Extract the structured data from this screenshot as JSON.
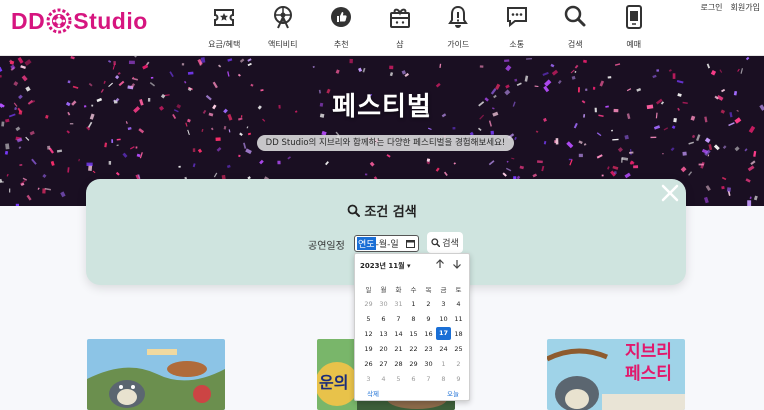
{
  "header": {
    "logo_text_left": "DD",
    "logo_text_right": "Studio",
    "nav": [
      {
        "label": "요금/혜택",
        "icon": "ticket-icon"
      },
      {
        "label": "액티비티",
        "icon": "ferris-wheel-icon"
      },
      {
        "label": "추천",
        "icon": "thumbs-up-icon"
      },
      {
        "label": "샵",
        "icon": "gift-box-icon"
      },
      {
        "label": "가이드",
        "icon": "bell-icon"
      },
      {
        "label": "소통",
        "icon": "chat-bubble-icon"
      },
      {
        "label": "검색",
        "icon": "search-icon"
      },
      {
        "label": "예매",
        "icon": "phone-ticket-icon"
      }
    ],
    "login": "로그인",
    "signup": "회원가입"
  },
  "hero": {
    "title": "페스티벌",
    "subtitle": "DD Studio의 지브리와 함께하는 다양한 페스티벌을 경험해보세요!"
  },
  "search_modal": {
    "title": "조건 검색",
    "date_label": "공연일정",
    "date_placeholder_year": "연도",
    "date_placeholder_rest": "-월-일",
    "search_button": "검색"
  },
  "calendar": {
    "month_label": "2023년 11월 ▾",
    "weekdays": [
      "일",
      "월",
      "화",
      "수",
      "목",
      "금",
      "토"
    ],
    "weeks": [
      [
        {
          "d": "29",
          "o": true
        },
        {
          "d": "30",
          "o": true
        },
        {
          "d": "31",
          "o": true
        },
        {
          "d": "1"
        },
        {
          "d": "2"
        },
        {
          "d": "3"
        },
        {
          "d": "4"
        }
      ],
      [
        {
          "d": "5"
        },
        {
          "d": "6"
        },
        {
          "d": "7"
        },
        {
          "d": "8"
        },
        {
          "d": "9"
        },
        {
          "d": "10"
        },
        {
          "d": "11"
        }
      ],
      [
        {
          "d": "12"
        },
        {
          "d": "13"
        },
        {
          "d": "14"
        },
        {
          "d": "15"
        },
        {
          "d": "16"
        },
        {
          "d": "17",
          "s": true
        },
        {
          "d": "18"
        }
      ],
      [
        {
          "d": "19"
        },
        {
          "d": "20"
        },
        {
          "d": "21"
        },
        {
          "d": "22"
        },
        {
          "d": "23"
        },
        {
          "d": "24"
        },
        {
          "d": "25"
        }
      ],
      [
        {
          "d": "26"
        },
        {
          "d": "27"
        },
        {
          "d": "28"
        },
        {
          "d": "29"
        },
        {
          "d": "30"
        },
        {
          "d": "1",
          "o": true
        },
        {
          "d": "2",
          "o": true
        }
      ],
      [
        {
          "d": "3",
          "o": true
        },
        {
          "d": "4",
          "o": true
        },
        {
          "d": "5",
          "o": true
        },
        {
          "d": "6",
          "o": true
        },
        {
          "d": "7",
          "o": true
        },
        {
          "d": "8",
          "o": true
        },
        {
          "d": "9",
          "o": true
        }
      ]
    ],
    "clear_label": "삭제",
    "today_label": "오늘"
  },
  "thumbnails": [
    {
      "text": ""
    },
    {
      "text": "운의"
    },
    {
      "text_line1": "지브리",
      "text_line2": "페스티"
    }
  ],
  "colors": {
    "brand": "#d6157f",
    "accent_blue": "#1a6fd6",
    "modal_bg": "#cfe4df"
  }
}
